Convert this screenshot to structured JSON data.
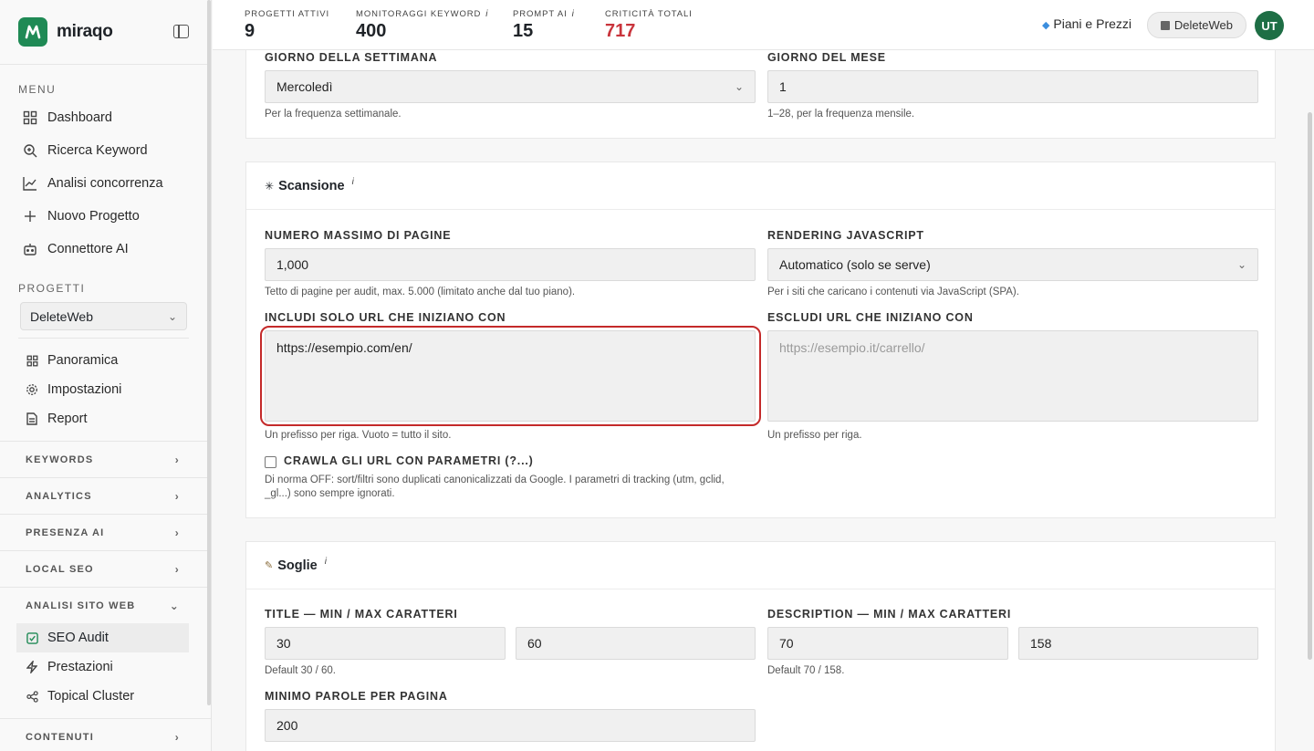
{
  "brand": {
    "name": "miraqo"
  },
  "sidebar": {
    "menu_label": "MENU",
    "menu": [
      {
        "label": "Dashboard",
        "icon": "grid-icon"
      },
      {
        "label": "Ricerca Keyword",
        "icon": "search-icon"
      },
      {
        "label": "Analisi concorrenza",
        "icon": "chart-line-icon"
      },
      {
        "label": "Nuovo Progetto",
        "icon": "plus-icon"
      },
      {
        "label": "Connettore AI",
        "icon": "robot-icon"
      }
    ],
    "projects_label": "PROGETTI",
    "project_selected": "DeleteWeb",
    "project_items": [
      {
        "label": "Panoramica",
        "icon": "grid-icon"
      },
      {
        "label": "Impostazioni",
        "icon": "gear-icon"
      },
      {
        "label": "Report",
        "icon": "document-icon"
      }
    ],
    "groups": [
      {
        "label": "KEYWORDS"
      },
      {
        "label": "ANALYTICS"
      },
      {
        "label": "PRESENZA AI"
      },
      {
        "label": "LOCAL SEO"
      },
      {
        "label": "ANALISI SITO WEB"
      }
    ],
    "analysis_items": [
      {
        "label": "SEO Audit",
        "icon": "check-square-icon",
        "active": true
      },
      {
        "label": "Prestazioni",
        "icon": "bolt-icon"
      },
      {
        "label": "Topical Cluster",
        "icon": "share-icon"
      }
    ],
    "last_group": "CONTENUTI"
  },
  "header": {
    "stats": [
      {
        "label": "PROGETTI ATTIVI",
        "value": "9",
        "info": false
      },
      {
        "label": "MONITORAGGI KEYWORD",
        "value": "400",
        "info": true
      },
      {
        "label": "PROMPT AI",
        "value": "15",
        "info": true
      },
      {
        "label": "CRITICITÀ TOTALI",
        "value": "717",
        "info": false,
        "color": "#c9343c"
      }
    ],
    "info_symbol": "i",
    "plans_label": "Piani e Prezzi",
    "user_chip": "DeleteWeb",
    "avatar": "UT"
  },
  "schedule": {
    "weekday_label": "GIORNO DELLA SETTIMANA",
    "weekday_value": "Mercoledì",
    "weekday_hint": "Per la frequenza settimanale.",
    "monthday_label": "GIORNO DEL MESE",
    "monthday_value": "1",
    "monthday_hint": "1–28, per la frequenza mensile."
  },
  "scan": {
    "title": "Scansione",
    "title_icon": "spider-icon",
    "max_pages_label": "NUMERO MASSIMO DI PAGINE",
    "max_pages_value": "1,000",
    "max_pages_hint": "Tetto di pagine per audit, max. 5.000 (limitato anche dal tuo piano).",
    "js_label": "RENDERING JAVASCRIPT",
    "js_value": "Automatico (solo se serve)",
    "js_hint": "Per i siti che caricano i contenuti via JavaScript (SPA).",
    "include_label": "INCLUDI SOLO URL CHE INIZIANO CON",
    "include_value": "https://esempio.com/en/",
    "include_hint": "Un prefisso per riga. Vuoto = tutto il sito.",
    "exclude_label": "ESCLUDI URL CHE INIZIANO CON",
    "exclude_placeholder": "https://esempio.it/carrello/",
    "exclude_hint": "Un prefisso per riga.",
    "params_label": "CRAWLA GLI URL CON PARAMETRI (?...)",
    "params_checked": false,
    "params_hint": "Di norma OFF: sort/filtri sono duplicati canonicalizzati da Google. I parametri di tracking (utm, gclid, _gl...) sono sempre ignorati."
  },
  "thresholds": {
    "title": "Soglie",
    "title_icon": "ruler-icon",
    "title_label": "TITLE — MIN / MAX CARATTERI",
    "title_min": "30",
    "title_max": "60",
    "title_hint": "Default 30 / 60.",
    "desc_label": "DESCRIPTION — MIN / MAX CARATTERI",
    "desc_min": "70",
    "desc_max": "158",
    "desc_hint": "Default 70 / 158.",
    "words_label": "MINIMO PAROLE PER PAGINA",
    "words_value": "200"
  },
  "colors": {
    "accent": "#1f8a55",
    "critical": "#c9343c",
    "highlight": "#c42a2a"
  }
}
